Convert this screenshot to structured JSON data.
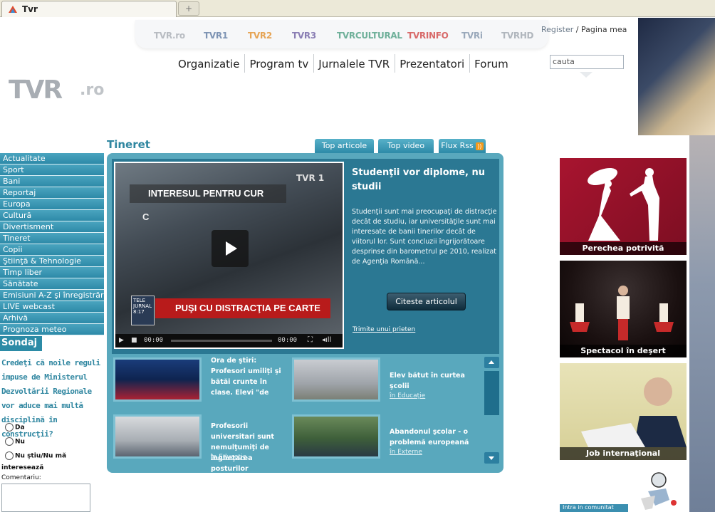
{
  "browser": {
    "tab_title": "Tvr",
    "new_tab_symbol": "+"
  },
  "channels": [
    {
      "label": "TVR.ro",
      "color": "#b8bcc2"
    },
    {
      "label": "TVR1",
      "color": "#7e94b4"
    },
    {
      "label": "TVR2",
      "color": "#e6a455"
    },
    {
      "label": "TVR3",
      "color": "#8a7eb4"
    },
    {
      "label": "TVRCULTURAL",
      "color": "#6fb09a"
    },
    {
      "label": "TVRINFO",
      "color": "#d86a6a"
    },
    {
      "label": "TVRi",
      "color": "#9aa9bb"
    },
    {
      "label": "TVRHD",
      "color": "#b0b6bd"
    }
  ],
  "account": {
    "register": "Register",
    "separator": " / ",
    "my_page": "Pagina mea"
  },
  "logo": {
    "main": "TVR",
    "suffix": ".ro"
  },
  "nav": [
    "Organizatie",
    "Program tv",
    "Jurnalele TVR",
    "Prezentatori",
    "Forum"
  ],
  "search": {
    "value": "cauta"
  },
  "sidebar": {
    "items": [
      "Actualitate",
      "Sport",
      "Bani",
      "Reportaj",
      "Europa",
      "Cultură",
      "Divertisment",
      "Tineret",
      "Copii",
      "Ştiinţă & Tehnologie",
      "Timp liber",
      "Sănătate",
      "Emisiuni A-Z şi înregistrări",
      "LIVE webcast",
      "Arhivă",
      "Prognoza meteo"
    ]
  },
  "poll": {
    "heading": "Sondaj",
    "question": "Credeţi că noile reguli impuse de Ministerul Dezvoltării Regionale vor aduce mai multă disciplină în construcţii?",
    "options": [
      "Da",
      "Nu",
      "Nu ştiu/Nu mă"
    ],
    "option_last_cont": "interesează",
    "comment_label": "Comentariu:"
  },
  "section": {
    "title": "Tineret",
    "tabs": {
      "top_articles": "Top articole",
      "top_video": "Top video",
      "rss": "Flux Rss"
    }
  },
  "video": {
    "caption_top": "INTERESUL PENTRU CUR",
    "caption_c": "C",
    "channel_tag": "TVR 1",
    "show_tag": "TELE JURNAL",
    "show_time": "8:17",
    "headline_bar": "PUŞI CU DISTRACŢIA PE CARTE",
    "time_current": "00:00",
    "time_total": "00:00"
  },
  "featured": {
    "title": "Studenţii vor diplome, nu studii",
    "text": "Studenţii sunt mai preocupaţi de distracţie decât de studiu, iar universităţile sunt mai interesate de banii tinerilor decât de viitorul lor. Sunt concluzii îngrijorătoare desprinse din barometrul pe 2010, realizat de Agenţia Română...",
    "button": "Citeste articolul",
    "send_link": "Trimite unui prieten"
  },
  "articles": [
    {
      "title": "Ora de ştiri: Profesori umiliţi şi bătăi crunte în clase. Elevi \"de needucat\" sau profesori care nu ştiu",
      "category": ""
    },
    {
      "title": "Elev bătut în curtea şcolii",
      "category": "în Educaţie"
    },
    {
      "title": "Profesorii universitari sunt nemulţumiţi de îngheţarea posturilor",
      "category": "în Educaţie"
    },
    {
      "title": "Abandonul şcolar - o problemă europeană",
      "category": "în Externe"
    }
  ],
  "promos": [
    {
      "caption": "Perechea potrivită"
    },
    {
      "caption": "Spectacol în deşert"
    },
    {
      "caption": "Job internaţional"
    }
  ],
  "community": {
    "label": "Intra in comunitat"
  },
  "colors": {
    "accent": "#2f86a0",
    "box": "#59a8bd",
    "dark": "#2b7893"
  }
}
